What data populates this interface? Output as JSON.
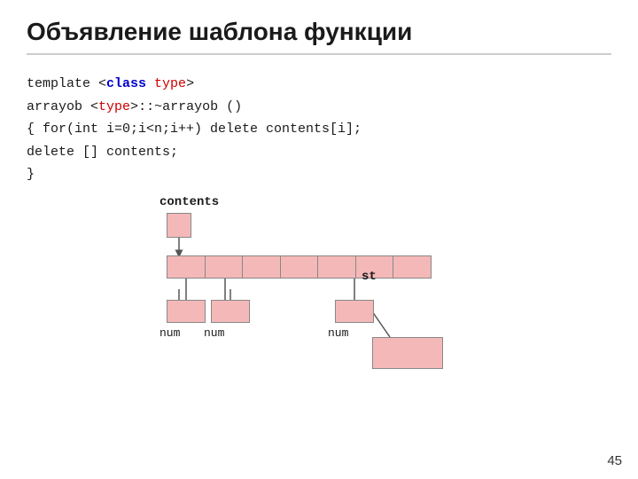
{
  "slide": {
    "title": "Объявление шаблона функции",
    "page_number": "45",
    "code": {
      "line1_prefix": "template ",
      "line1_mid": "<class ",
      "line1_type": "type",
      "line1_suffix": ">",
      "line2_prefix": "   arrayob ",
      "line2_type": "<type>",
      "line2_suffix": "::~arrayob ()",
      "line3": "   {   for(int i=0;i<n;i++) delete contents[i];",
      "line4": "      delete [] contents;",
      "line5": "   }"
    },
    "diagram": {
      "label_contents": "contents",
      "label_st": "st",
      "label_num1": "num",
      "label_num2": "num",
      "label_num3": "num"
    }
  }
}
